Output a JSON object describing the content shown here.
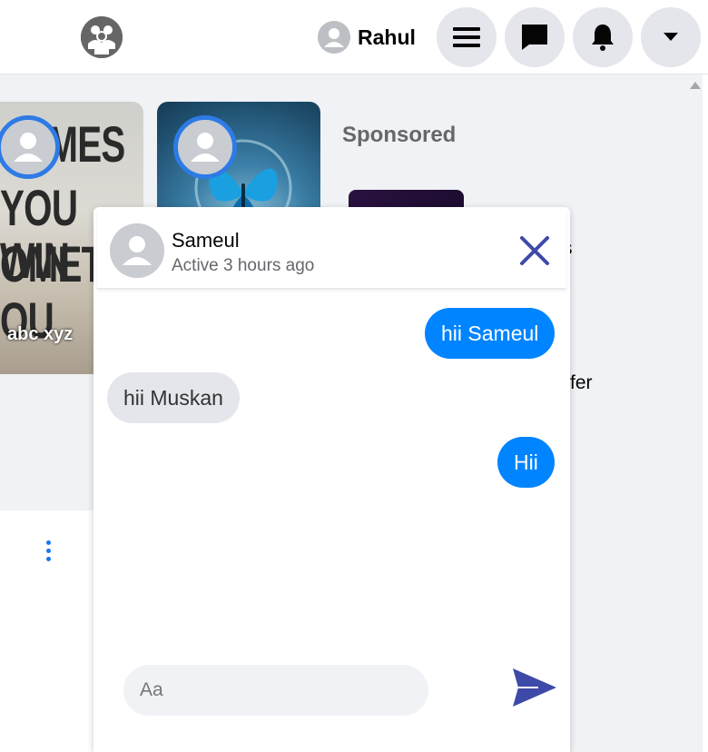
{
  "topbar": {
    "logo_icon": "people-logo-icon",
    "user_name": "Rahul",
    "buttons": [
      "menu-icon",
      "messenger-icon",
      "bell-icon",
      "caret-down-icon"
    ]
  },
  "stories": [
    {
      "text_lines": [
        "TIMES",
        "YOU WIN",
        "OMETIM",
        "OU"
      ],
      "label": "abc xyz"
    },
    {
      "label": ""
    }
  ],
  "sponsored": {
    "heading": "Sponsored",
    "ad_text_fragment": "fer",
    "ad_text_fragment2": "s"
  },
  "chat": {
    "contact_name": "Sameul",
    "status": "Active 3 hours ago",
    "messages": [
      {
        "from": "me",
        "text": "hii Sameul"
      },
      {
        "from": "them",
        "text": "hii Muskan"
      },
      {
        "from": "me",
        "text": "Hii"
      }
    ],
    "input_placeholder": "Aa"
  },
  "colors": {
    "accent_blue": "#0084ff",
    "story_ring": "#2d7be5",
    "icon_navy": "#3d4aa8"
  }
}
